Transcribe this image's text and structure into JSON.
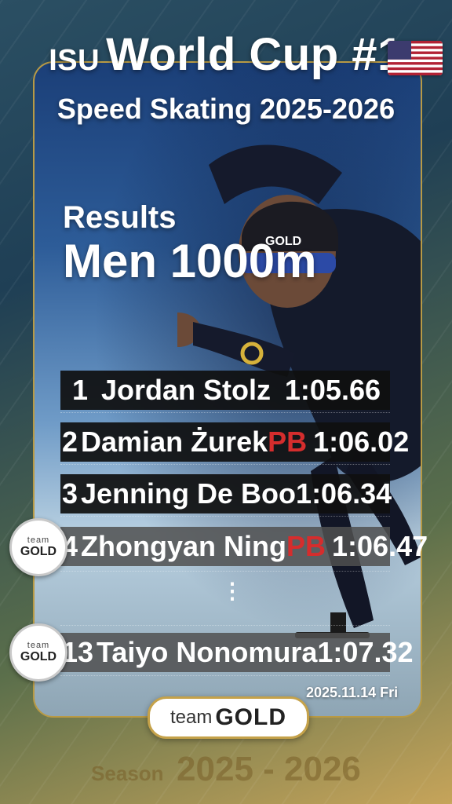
{
  "header": {
    "isu": "ISU",
    "title": "World Cup #1",
    "subtitle": "Speed Skating 2025-2026",
    "flag_icon": "usa-flag-icon"
  },
  "results_label": "Results",
  "event": "Men 1000m",
  "rows": [
    {
      "rank": "1",
      "name": "Jordan Stolz",
      "pb": "",
      "time": "1:05.66"
    },
    {
      "rank": "2",
      "name": "Damian Żurek",
      "pb": "PB",
      "time": "1:06.02"
    },
    {
      "rank": "3",
      "name": "Jenning De Boo",
      "pb": "",
      "time": "1:06.34"
    },
    {
      "rank": "4",
      "name": "Zhongyan Ning",
      "pb": "PB",
      "time": "1:06.47"
    },
    {
      "rank": "13",
      "name": "Taiyo Nonomura",
      "pb": "",
      "time": "1:07.32"
    }
  ],
  "ellipsis": "⋮",
  "badge": {
    "team": "team",
    "gold": "GOLD"
  },
  "date": "2025.11.14 Fri",
  "brand": {
    "team": "team",
    "gold": "GOLD"
  },
  "season": {
    "label": "Season",
    "years": "2025 - 2026"
  },
  "colors": {
    "pb": "#d52d2d",
    "gold_border": "#b89a45"
  }
}
